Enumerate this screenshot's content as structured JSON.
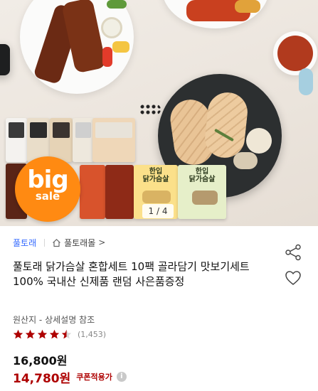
{
  "hero": {
    "badge": {
      "big": "big",
      "sale": "sale"
    },
    "pack_labels": {
      "pack_1": "한입\n닭가슴살",
      "pack_2": "한입\n닭가슴살"
    },
    "counter": "1 / 4"
  },
  "product": {
    "brand": "풀토래",
    "store": "풀토래몰",
    "store_chevron": ">",
    "title": "풀토래 닭가슴살 혼합세트 10팩 골라담기 맛보기세트 100% 국내산 신제품 랜덤 사은품증정",
    "origin": "원산지 - 상세설명 참조",
    "rating": 4.5,
    "review_count": "(1,453)",
    "price_original": "16,800원",
    "price_sale": "14,780원",
    "coupon_label": "쿠폰적용가",
    "info_icon": "i"
  },
  "colors": {
    "brand_link": "#346aff",
    "sale_price": "#ae0000",
    "star": "#ae0000",
    "badge": "#ff8a12"
  },
  "icons": {
    "home": "house-icon",
    "share": "share-icon",
    "wishlist": "heart-icon",
    "info": "info-icon",
    "star": "star-icon"
  }
}
